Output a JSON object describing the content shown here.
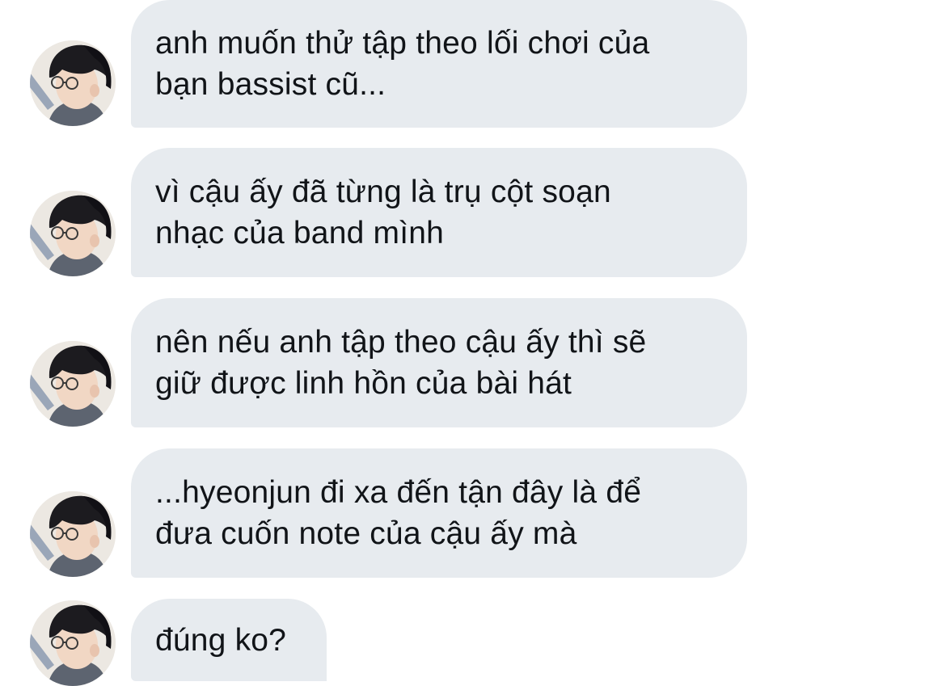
{
  "messages": [
    {
      "lines": [
        "anh muốn thử tập theo lối chơi của",
        "bạn bassist cũ..."
      ]
    },
    {
      "lines": [
        "vì cậu ấy đã từng là trụ cột soạn",
        "nhạc của band mình"
      ]
    },
    {
      "lines": [
        "nên nếu anh tập theo cậu ấy thì sẽ",
        "giữ được linh hồn của bài hát"
      ]
    },
    {
      "lines": [
        "...hyeonjun đi xa đến tận đây là để",
        "đưa cuốn note của cậu ấy mà"
      ]
    },
    {
      "lines": [
        "đúng ko?"
      ]
    }
  ],
  "colors": {
    "bubble_bg": "#e7ebef",
    "text": "#111418",
    "background": "#ffffff"
  },
  "icons": {
    "avatar": "user-avatar-icon"
  }
}
